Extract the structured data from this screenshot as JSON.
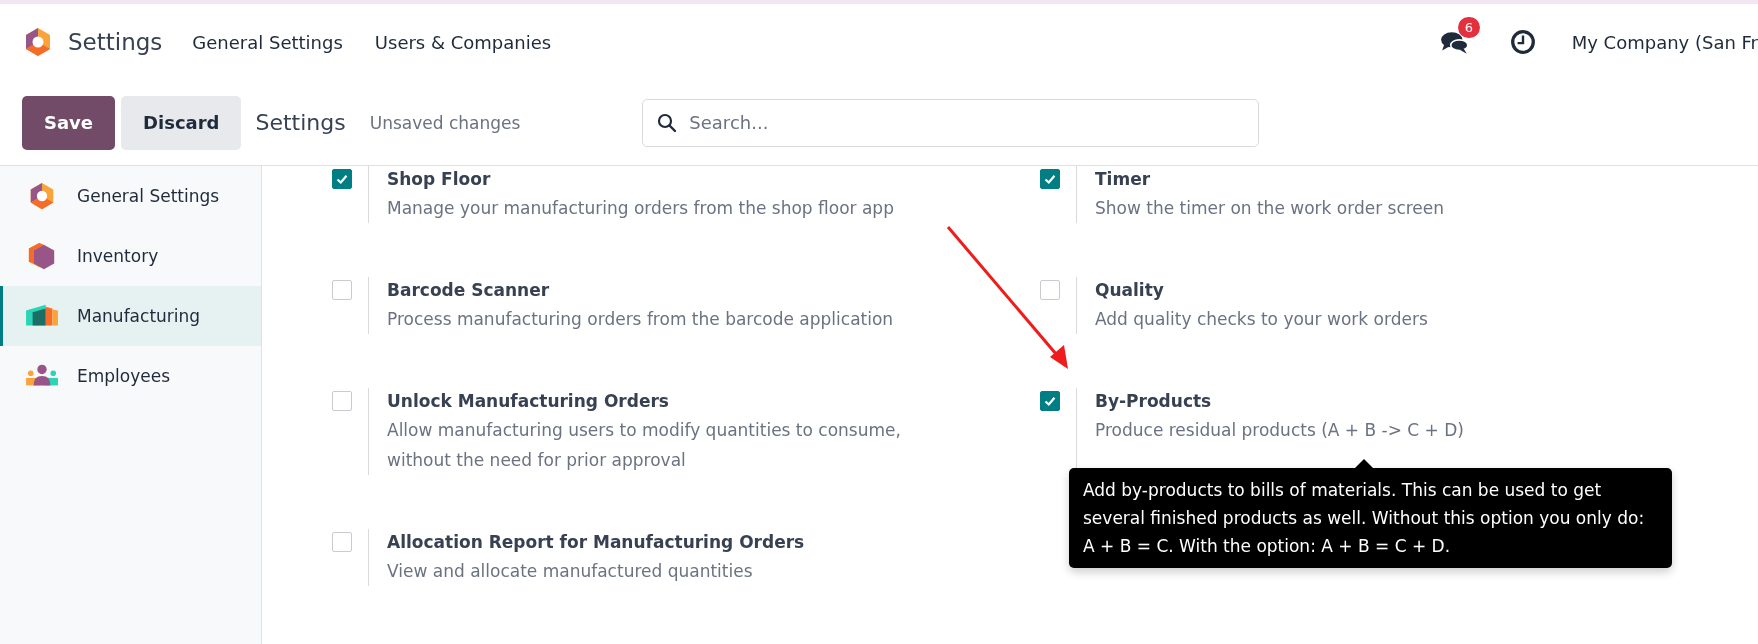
{
  "navbar": {
    "app_title": "Settings",
    "menu": [
      "General Settings",
      "Users & Companies"
    ],
    "messages_badge": "6",
    "company": "My Company (San Fr"
  },
  "control_bar": {
    "buttons": [
      "Save",
      "Discard"
    ],
    "breadcrumb": "Settings",
    "status": "Unsaved changes",
    "search": {
      "placeholder": "Search..."
    }
  },
  "sidebar": {
    "items": [
      {
        "label": "General Settings",
        "kind": "general",
        "selected": false
      },
      {
        "label": "Inventory",
        "kind": "inventory",
        "selected": false
      },
      {
        "label": "Manufacturing",
        "kind": "manufacturing",
        "selected": true
      },
      {
        "label": "Employees",
        "kind": "employees",
        "selected": false
      }
    ]
  },
  "settings": [
    {
      "title": "Shop Floor",
      "description": "Manage your manufacturing orders from the shop floor app",
      "checked": true
    },
    {
      "title": "Timer",
      "description": "Show the timer on the work order screen",
      "checked": true
    },
    {
      "title": "Barcode Scanner",
      "description": "Process manufacturing orders from the barcode application",
      "checked": false
    },
    {
      "title": "Quality",
      "description": "Add quality checks to your work orders",
      "checked": false
    },
    {
      "title": "Unlock Manufacturing Orders",
      "description": "Allow manufacturing users to modify quantities to consume, without the need for prior approval",
      "checked": false
    },
    {
      "title": "By-Products",
      "description": "Produce residual products (A + B -> C + D)",
      "checked": true,
      "tooltip": "Add by-products to bills of materials. This can be used to get several finished products as well. Without this option you only do: A + B = C. With the option: A + B = C + D."
    },
    {
      "title": "Allocation Report for Manufacturing Orders",
      "description": "View and allocate manufactured quantities",
      "checked": false
    }
  ]
}
